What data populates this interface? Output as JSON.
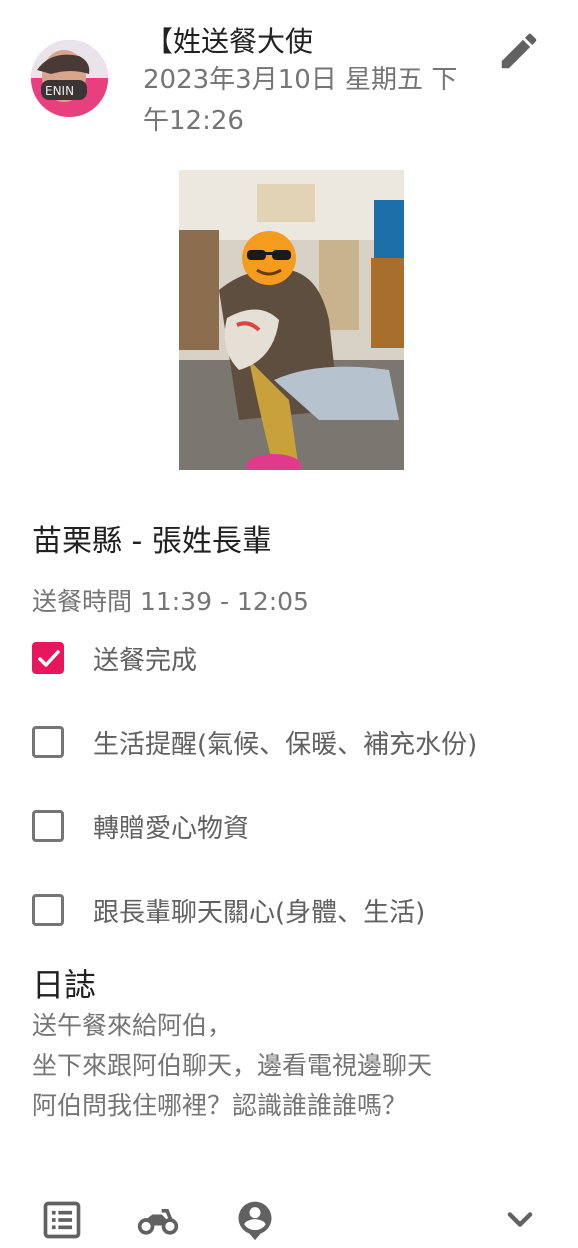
{
  "post": {
    "author": "【姓送餐大使",
    "datetime": "2023年3月10日 星期五 下午12:26",
    "datetime_line1": "2023年3月10日 星期五 下",
    "datetime_line2": "午12:26"
  },
  "record": {
    "place": "苗栗縣 - 張姓長輩",
    "delivery_time": "送餐時間 11:39 - 12:05"
  },
  "checklist": [
    {
      "label": "送餐完成",
      "checked": true
    },
    {
      "label": "生活提醒(氣候、保暖、補充水份)",
      "checked": false
    },
    {
      "label": "轉贈愛心物資",
      "checked": false
    },
    {
      "label": "跟長輩聊天關心(身體、生活)",
      "checked": false
    }
  ],
  "log": {
    "title": "日誌",
    "lines": [
      "送午餐來給阿伯，",
      "坐下來跟阿伯聊天，邊看電視邊聊天",
      "阿伯問我住哪裡？認識誰誰誰嗎？"
    ]
  },
  "icons": {
    "edit": "pencil-icon",
    "list": "list-icon",
    "delivery": "motorcycle-icon",
    "account": "account-icon",
    "expand": "chevron-down-icon"
  },
  "colors": {
    "accent": "#e8175d",
    "icon_gray": "#616161",
    "muted_text": "#757575"
  }
}
